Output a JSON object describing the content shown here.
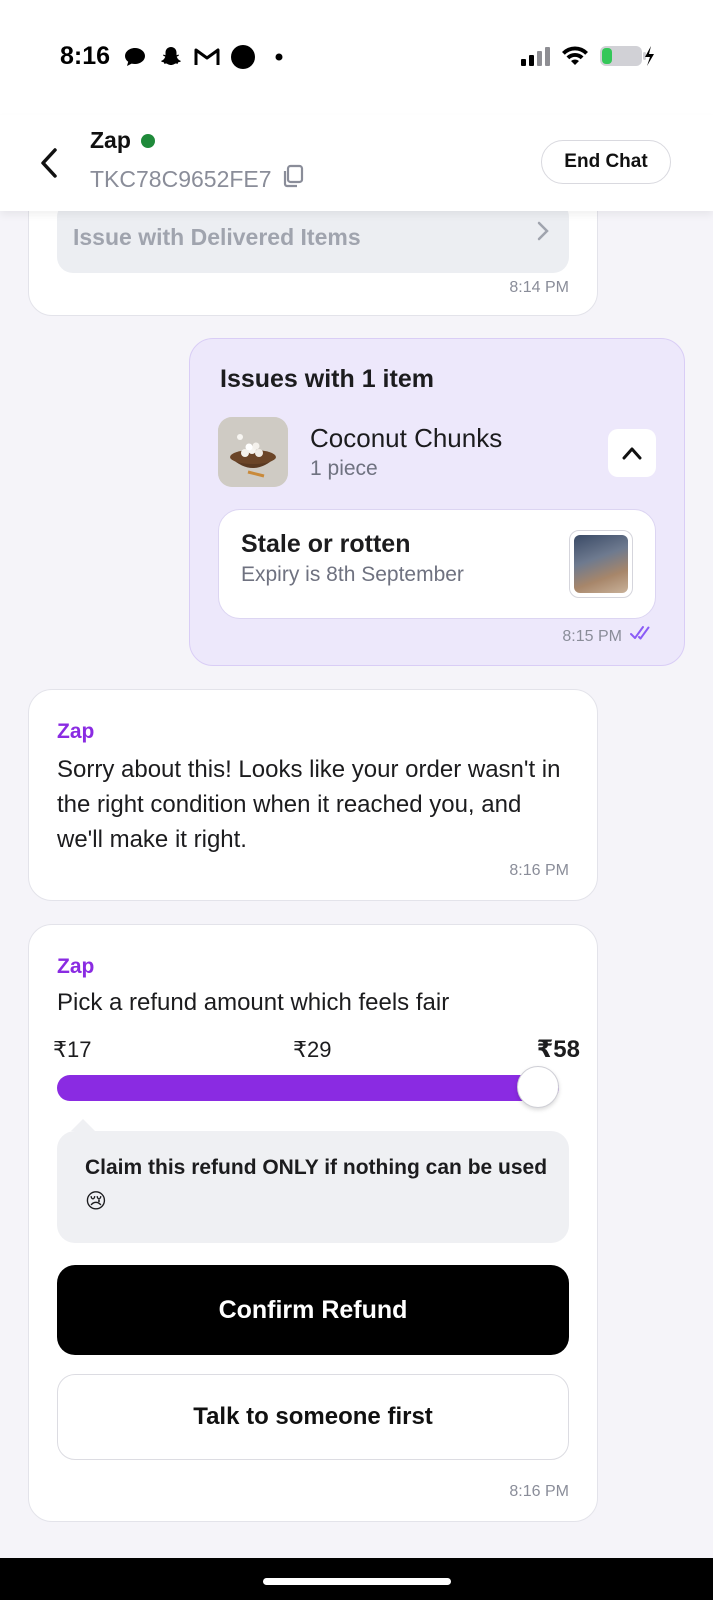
{
  "status_bar": {
    "time": "8:16",
    "left_icons": [
      "message-icon",
      "snapchat-icon",
      "gmail-icon",
      "circle-icon",
      "dot-icon"
    ],
    "right_icons": [
      "signal-icon",
      "wifi-icon",
      "battery-charging-icon"
    ]
  },
  "header": {
    "agent_name": "Zap",
    "ticket_id": "TKC78C9652FE7",
    "end_chat_label": "End Chat"
  },
  "messages": {
    "first": {
      "option_label": "Issue with Delivered Items",
      "time": "8:14 PM"
    },
    "user_issue": {
      "title": "Issues with 1 item",
      "item_name": "Coconut Chunks",
      "item_qty": "1 piece",
      "issue_title": "Stale or rotten",
      "issue_detail": "Expiry is 8th September",
      "time": "8:15 PM"
    },
    "apology": {
      "sender": "Zap",
      "text": "Sorry about this! Looks like your order wasn't in the right condition when it reached you, and we'll make it right.",
      "time": "8:16 PM"
    },
    "refund": {
      "sender": "Zap",
      "prompt": "Pick a refund amount which feels fair",
      "amounts": [
        "₹17",
        "₹29",
        "₹58"
      ],
      "selected_amount": "₹58",
      "slider_level": 1.0,
      "tooltip": "Claim this refund ONLY if nothing can be used 😢",
      "confirm_label": "Confirm Refund",
      "talk_label": "Talk to someone first",
      "time": "8:16 PM"
    }
  },
  "colors": {
    "accent": "#8a2be2",
    "user_bubble": "#ede8fb",
    "online": "#1f8a3a"
  }
}
